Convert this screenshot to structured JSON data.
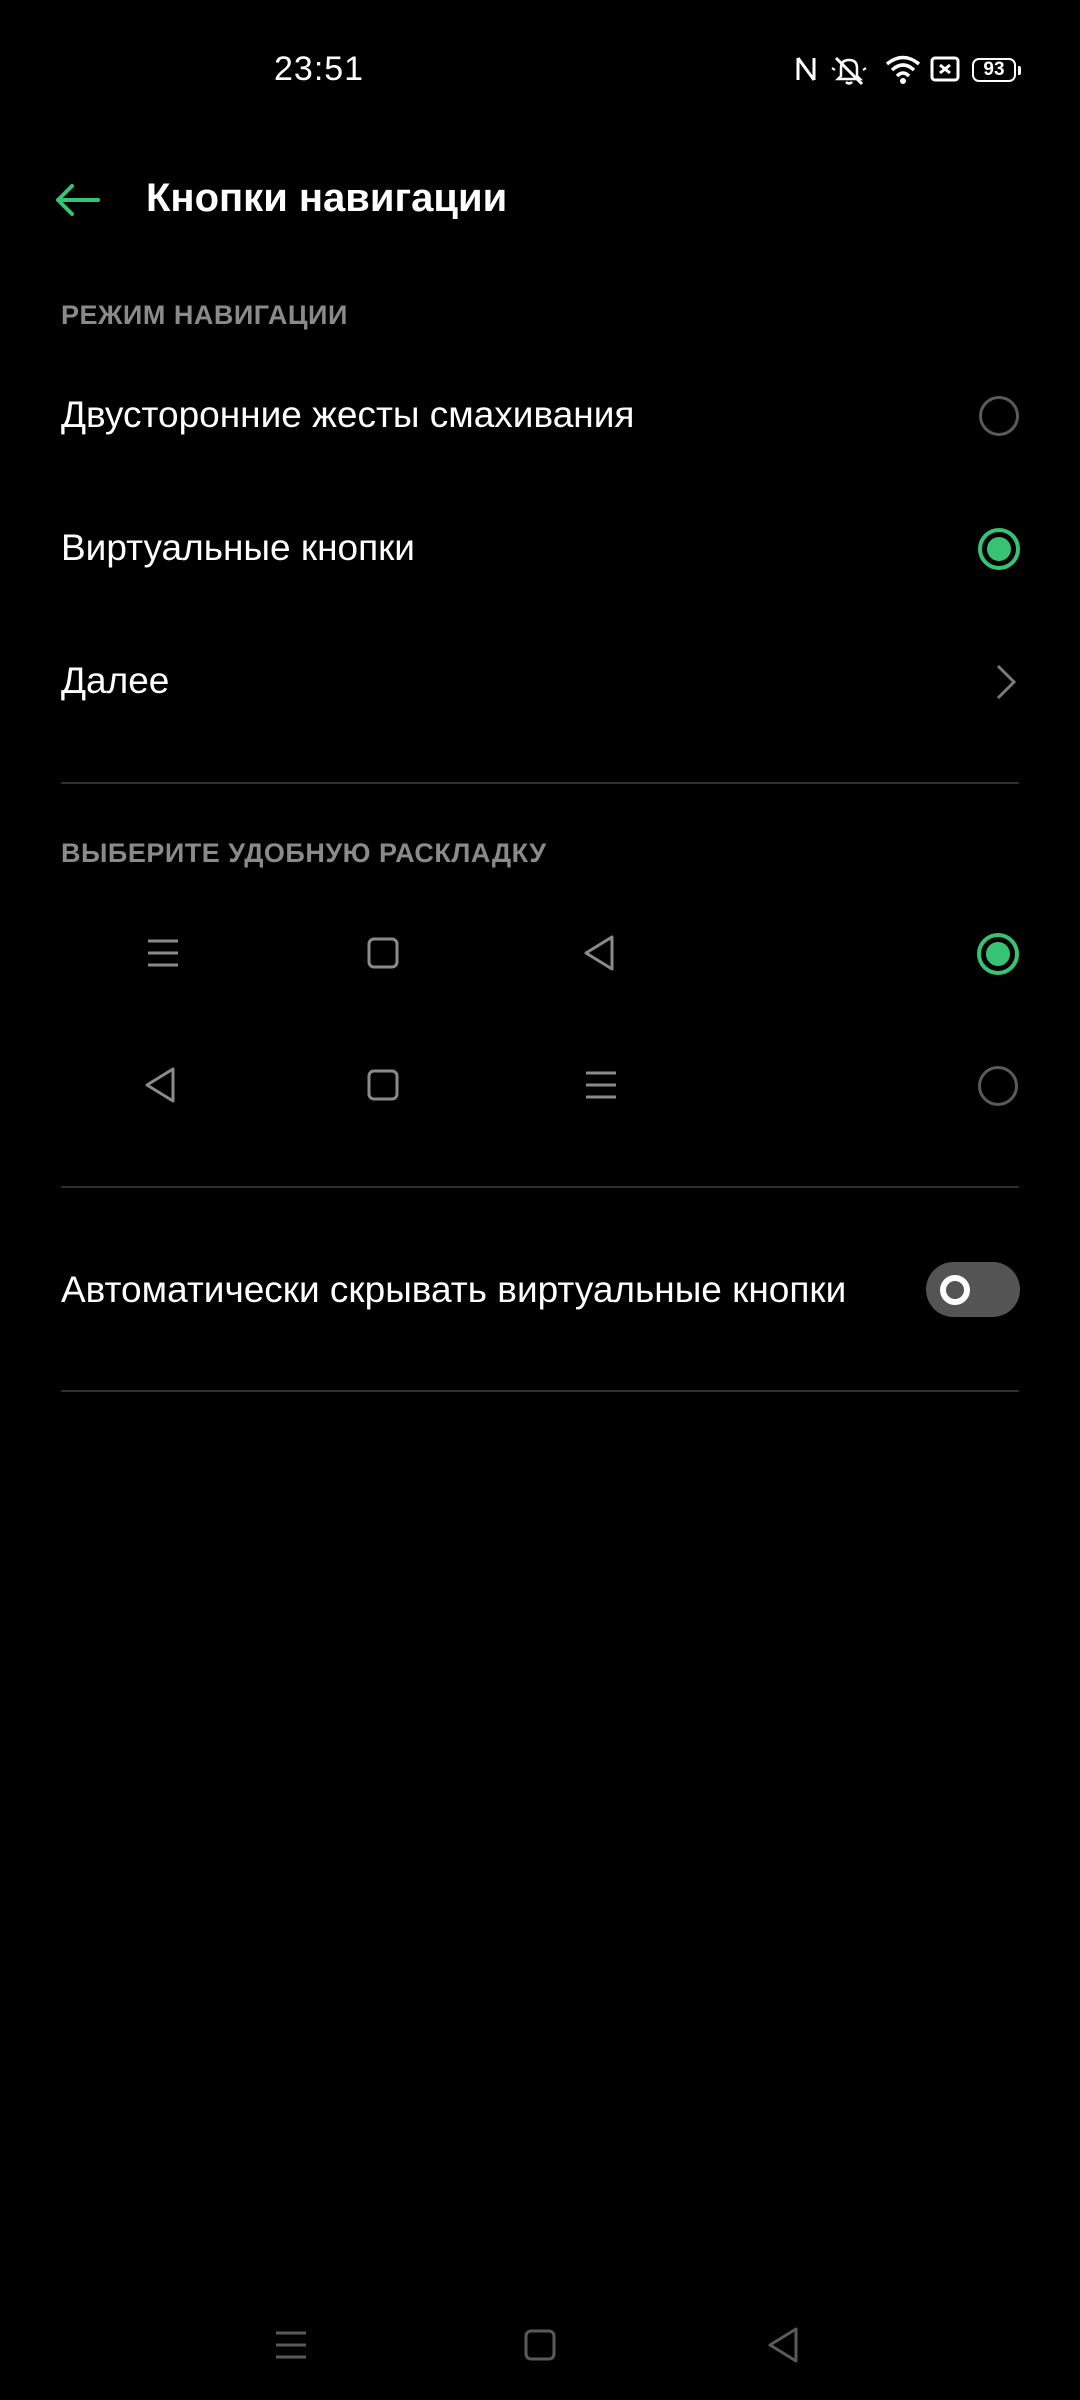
{
  "status_bar": {
    "time": "23:51",
    "battery": "93",
    "icons": [
      "nfc-icon",
      "mute-icon",
      "wifi-icon",
      "screen-record-icon",
      "battery-icon"
    ]
  },
  "header": {
    "title": "Кнопки навигации",
    "back_icon": "back-arrow-icon"
  },
  "navigation_mode": {
    "section_title": "РЕЖИМ НАВИГАЦИИ",
    "options": [
      {
        "label": "Двусторонние жесты смахивания",
        "selected": false
      },
      {
        "label": "Виртуальные кнопки",
        "selected": true
      }
    ],
    "more_label": "Далее"
  },
  "layout": {
    "section_title": "ВЫБЕРИТЕ УДОБНУЮ РАСКЛАДКУ",
    "options": [
      {
        "icons": [
          "menu-icon",
          "home-square-icon",
          "back-triangle-icon"
        ],
        "selected": true
      },
      {
        "icons": [
          "back-triangle-icon",
          "home-square-icon",
          "menu-icon"
        ],
        "selected": false
      }
    ]
  },
  "auto_hide": {
    "label": "Автоматически скрывать виртуальные кнопки",
    "enabled": false
  },
  "nav_bar": {
    "icons": [
      "menu-icon",
      "home-square-icon",
      "back-triangle-icon"
    ]
  },
  "colors": {
    "accent": "#37c374",
    "background": "#000000",
    "secondary_text": "#8a8a8a"
  }
}
